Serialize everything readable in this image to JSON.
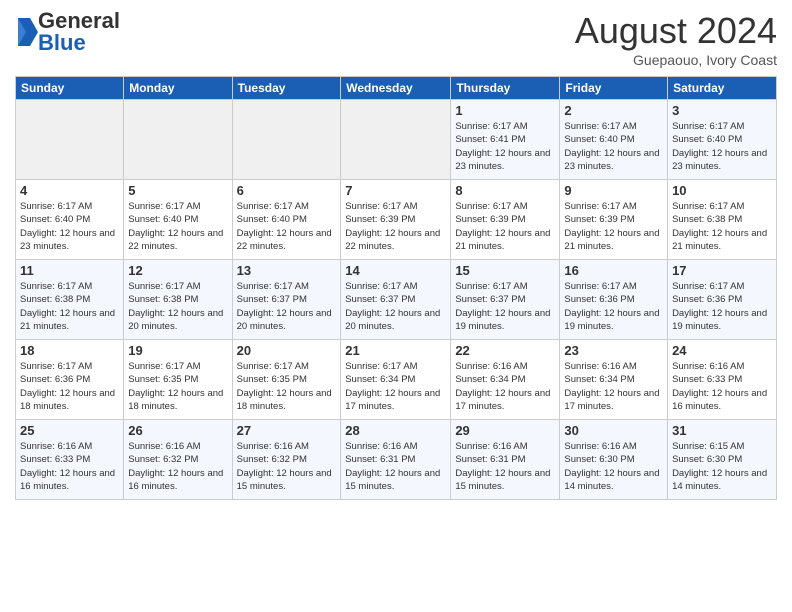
{
  "logo": {
    "general": "General",
    "blue": "Blue"
  },
  "title": "August 2024",
  "subtitle": "Guepaouo, Ivory Coast",
  "days_header": [
    "Sunday",
    "Monday",
    "Tuesday",
    "Wednesday",
    "Thursday",
    "Friday",
    "Saturday"
  ],
  "weeks": [
    [
      {
        "day": "",
        "info": ""
      },
      {
        "day": "",
        "info": ""
      },
      {
        "day": "",
        "info": ""
      },
      {
        "day": "",
        "info": ""
      },
      {
        "day": "1",
        "info": "Sunrise: 6:17 AM\nSunset: 6:41 PM\nDaylight: 12 hours and 23 minutes."
      },
      {
        "day": "2",
        "info": "Sunrise: 6:17 AM\nSunset: 6:40 PM\nDaylight: 12 hours and 23 minutes."
      },
      {
        "day": "3",
        "info": "Sunrise: 6:17 AM\nSunset: 6:40 PM\nDaylight: 12 hours and 23 minutes."
      }
    ],
    [
      {
        "day": "4",
        "info": "Sunrise: 6:17 AM\nSunset: 6:40 PM\nDaylight: 12 hours and 23 minutes."
      },
      {
        "day": "5",
        "info": "Sunrise: 6:17 AM\nSunset: 6:40 PM\nDaylight: 12 hours and 22 minutes."
      },
      {
        "day": "6",
        "info": "Sunrise: 6:17 AM\nSunset: 6:40 PM\nDaylight: 12 hours and 22 minutes."
      },
      {
        "day": "7",
        "info": "Sunrise: 6:17 AM\nSunset: 6:39 PM\nDaylight: 12 hours and 22 minutes."
      },
      {
        "day": "8",
        "info": "Sunrise: 6:17 AM\nSunset: 6:39 PM\nDaylight: 12 hours and 21 minutes."
      },
      {
        "day": "9",
        "info": "Sunrise: 6:17 AM\nSunset: 6:39 PM\nDaylight: 12 hours and 21 minutes."
      },
      {
        "day": "10",
        "info": "Sunrise: 6:17 AM\nSunset: 6:38 PM\nDaylight: 12 hours and 21 minutes."
      }
    ],
    [
      {
        "day": "11",
        "info": "Sunrise: 6:17 AM\nSunset: 6:38 PM\nDaylight: 12 hours and 21 minutes."
      },
      {
        "day": "12",
        "info": "Sunrise: 6:17 AM\nSunset: 6:38 PM\nDaylight: 12 hours and 20 minutes."
      },
      {
        "day": "13",
        "info": "Sunrise: 6:17 AM\nSunset: 6:37 PM\nDaylight: 12 hours and 20 minutes."
      },
      {
        "day": "14",
        "info": "Sunrise: 6:17 AM\nSunset: 6:37 PM\nDaylight: 12 hours and 20 minutes."
      },
      {
        "day": "15",
        "info": "Sunrise: 6:17 AM\nSunset: 6:37 PM\nDaylight: 12 hours and 19 minutes."
      },
      {
        "day": "16",
        "info": "Sunrise: 6:17 AM\nSunset: 6:36 PM\nDaylight: 12 hours and 19 minutes."
      },
      {
        "day": "17",
        "info": "Sunrise: 6:17 AM\nSunset: 6:36 PM\nDaylight: 12 hours and 19 minutes."
      }
    ],
    [
      {
        "day": "18",
        "info": "Sunrise: 6:17 AM\nSunset: 6:36 PM\nDaylight: 12 hours and 18 minutes."
      },
      {
        "day": "19",
        "info": "Sunrise: 6:17 AM\nSunset: 6:35 PM\nDaylight: 12 hours and 18 minutes."
      },
      {
        "day": "20",
        "info": "Sunrise: 6:17 AM\nSunset: 6:35 PM\nDaylight: 12 hours and 18 minutes."
      },
      {
        "day": "21",
        "info": "Sunrise: 6:17 AM\nSunset: 6:34 PM\nDaylight: 12 hours and 17 minutes."
      },
      {
        "day": "22",
        "info": "Sunrise: 6:16 AM\nSunset: 6:34 PM\nDaylight: 12 hours and 17 minutes."
      },
      {
        "day": "23",
        "info": "Sunrise: 6:16 AM\nSunset: 6:34 PM\nDaylight: 12 hours and 17 minutes."
      },
      {
        "day": "24",
        "info": "Sunrise: 6:16 AM\nSunset: 6:33 PM\nDaylight: 12 hours and 16 minutes."
      }
    ],
    [
      {
        "day": "25",
        "info": "Sunrise: 6:16 AM\nSunset: 6:33 PM\nDaylight: 12 hours and 16 minutes."
      },
      {
        "day": "26",
        "info": "Sunrise: 6:16 AM\nSunset: 6:32 PM\nDaylight: 12 hours and 16 minutes."
      },
      {
        "day": "27",
        "info": "Sunrise: 6:16 AM\nSunset: 6:32 PM\nDaylight: 12 hours and 15 minutes."
      },
      {
        "day": "28",
        "info": "Sunrise: 6:16 AM\nSunset: 6:31 PM\nDaylight: 12 hours and 15 minutes."
      },
      {
        "day": "29",
        "info": "Sunrise: 6:16 AM\nSunset: 6:31 PM\nDaylight: 12 hours and 15 minutes."
      },
      {
        "day": "30",
        "info": "Sunrise: 6:16 AM\nSunset: 6:30 PM\nDaylight: 12 hours and 14 minutes."
      },
      {
        "day": "31",
        "info": "Sunrise: 6:15 AM\nSunset: 6:30 PM\nDaylight: 12 hours and 14 minutes."
      }
    ]
  ]
}
